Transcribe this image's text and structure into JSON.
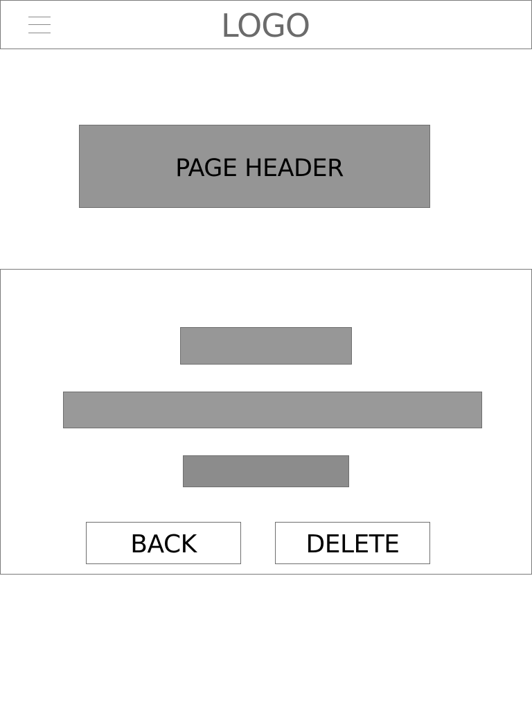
{
  "topbar": {
    "menu_icon": "hamburger-menu-icon",
    "logo_text": "LOGO"
  },
  "page_header": {
    "title": "PAGE HEADER"
  },
  "content": {
    "buttons": {
      "back_label": "BACK",
      "delete_label": "DELETE"
    }
  },
  "colors": {
    "border": "#7a7a7a",
    "header_fill": "#959595",
    "placeholder_fill": "#999999",
    "logo_text": "#6b6b6b"
  }
}
